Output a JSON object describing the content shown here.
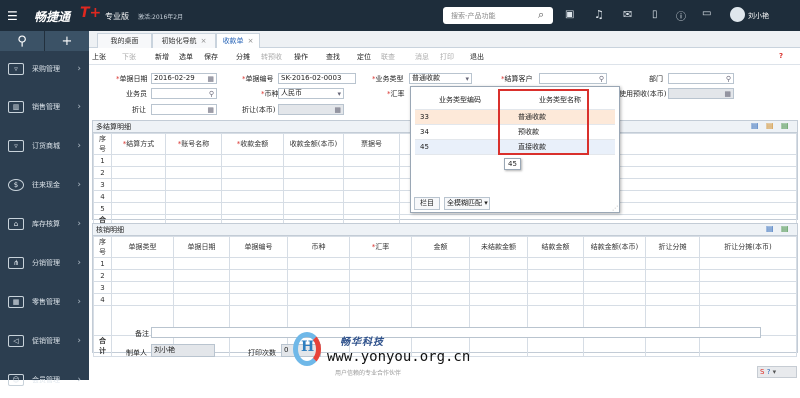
{
  "app": {
    "name": "畅捷通",
    "tplus": "T+",
    "edition": "专业版",
    "activation": "激活:2016年2月",
    "search_placeholder": "搜索-产品功能",
    "user_name": "刘小艳"
  },
  "sidebar": {
    "items": [
      {
        "label": "采购管理",
        "icon": "cart-icon"
      },
      {
        "label": "销售管理",
        "icon": "bar-chart-icon"
      },
      {
        "label": "订货商城",
        "icon": "shopping-cart-icon"
      },
      {
        "label": "往来现金",
        "icon": "currency-icon"
      },
      {
        "label": "库存核算",
        "icon": "warehouse-icon"
      },
      {
        "label": "分销管理",
        "icon": "distribution-icon"
      },
      {
        "label": "零售管理",
        "icon": "store-icon"
      },
      {
        "label": "促销管理",
        "icon": "megaphone-icon"
      },
      {
        "label": "会员管理",
        "icon": "member-icon"
      }
    ]
  },
  "tabs": [
    "我的桌面",
    "初始化导航",
    "收款单"
  ],
  "toolbar": {
    "items": [
      "上张",
      "下张",
      "新增",
      "选单",
      "保存",
      "分摊",
      "转预收",
      "操作",
      "查找",
      "定位",
      "联查",
      "消息",
      "打印",
      "退出"
    ],
    "disabled": [
      1,
      6,
      10,
      11,
      12
    ]
  },
  "form": {
    "doc_date_label": "单据日期",
    "doc_date": "2016-02-29",
    "doc_no_label": "单据编号",
    "doc_no": "SK-2016-02-0003",
    "biz_type_label": "业务类型",
    "biz_type": "普通收款",
    "customer_label": "结算客户",
    "customer": "",
    "dept_label": "部门",
    "salesman_label": "业务员",
    "currency_label": "币种",
    "currency": "人民币",
    "rate_label": "汇率",
    "prepay_label": "使用预收(本币)",
    "discount_label": "折让",
    "discount_base_label": "折让(本币)"
  },
  "settle": {
    "title": "多结算明细",
    "columns": [
      "序号",
      "结算方式",
      "账号名称",
      "收款金额",
      "收款金额(本币)",
      "票据号"
    ],
    "rows": [
      "1",
      "2",
      "3",
      "4",
      "5"
    ],
    "total_label": "合计"
  },
  "verify": {
    "title": "核销明细",
    "columns": [
      "序号",
      "单据类型",
      "单据日期",
      "单据编号",
      "币种",
      "汇率",
      "金额",
      "未结款金额",
      "结款金额",
      "结款金额(本币)",
      "折让分摊",
      "折让分摊(本币)"
    ],
    "rows": [
      "1",
      "2",
      "3",
      "4"
    ],
    "total_label": "合计"
  },
  "footer": {
    "remark_label": "备注",
    "maker_label": "制单人",
    "maker": "刘小艳",
    "print_count_label": "打印次数",
    "print_count": "0"
  },
  "popup": {
    "col_code": "业务类型编码",
    "col_name": "业务类型名称",
    "rows": [
      {
        "code": "33",
        "name": "普通收款"
      },
      {
        "code": "34",
        "name": "预收款"
      },
      {
        "code": "45",
        "name": "直接收款"
      }
    ],
    "tooltip": "45",
    "btn_columns": "栏目",
    "btn_match": "全模糊匹配"
  },
  "watermark": {
    "brand": "畅华科技",
    "url": "www.yonyou.org.cn",
    "slogan": "用户信赖的专业合作伙伴"
  },
  "colors": {
    "topbar": "#1e2d3b",
    "sidebar": "#2c3e50",
    "required": "#d9302c",
    "highlight_box": "#d9302c"
  }
}
